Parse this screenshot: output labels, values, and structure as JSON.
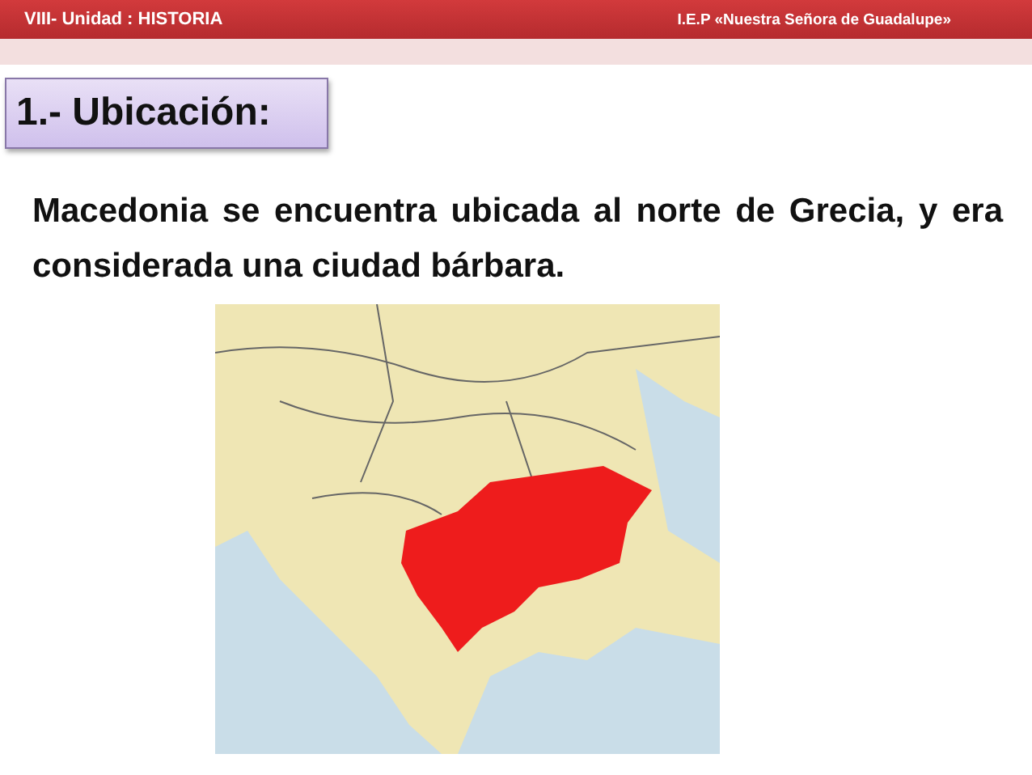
{
  "header": {
    "unit": "VIII- Unidad : HISTORIA",
    "school": "I.E.P «Nuestra Señora de Guadalupe»"
  },
  "section_title": "1.- Ubicación:",
  "paragraph": "Macedonia se encuentra ubicada al norte de Grecia, y era considerada una ciudad bárbara."
}
